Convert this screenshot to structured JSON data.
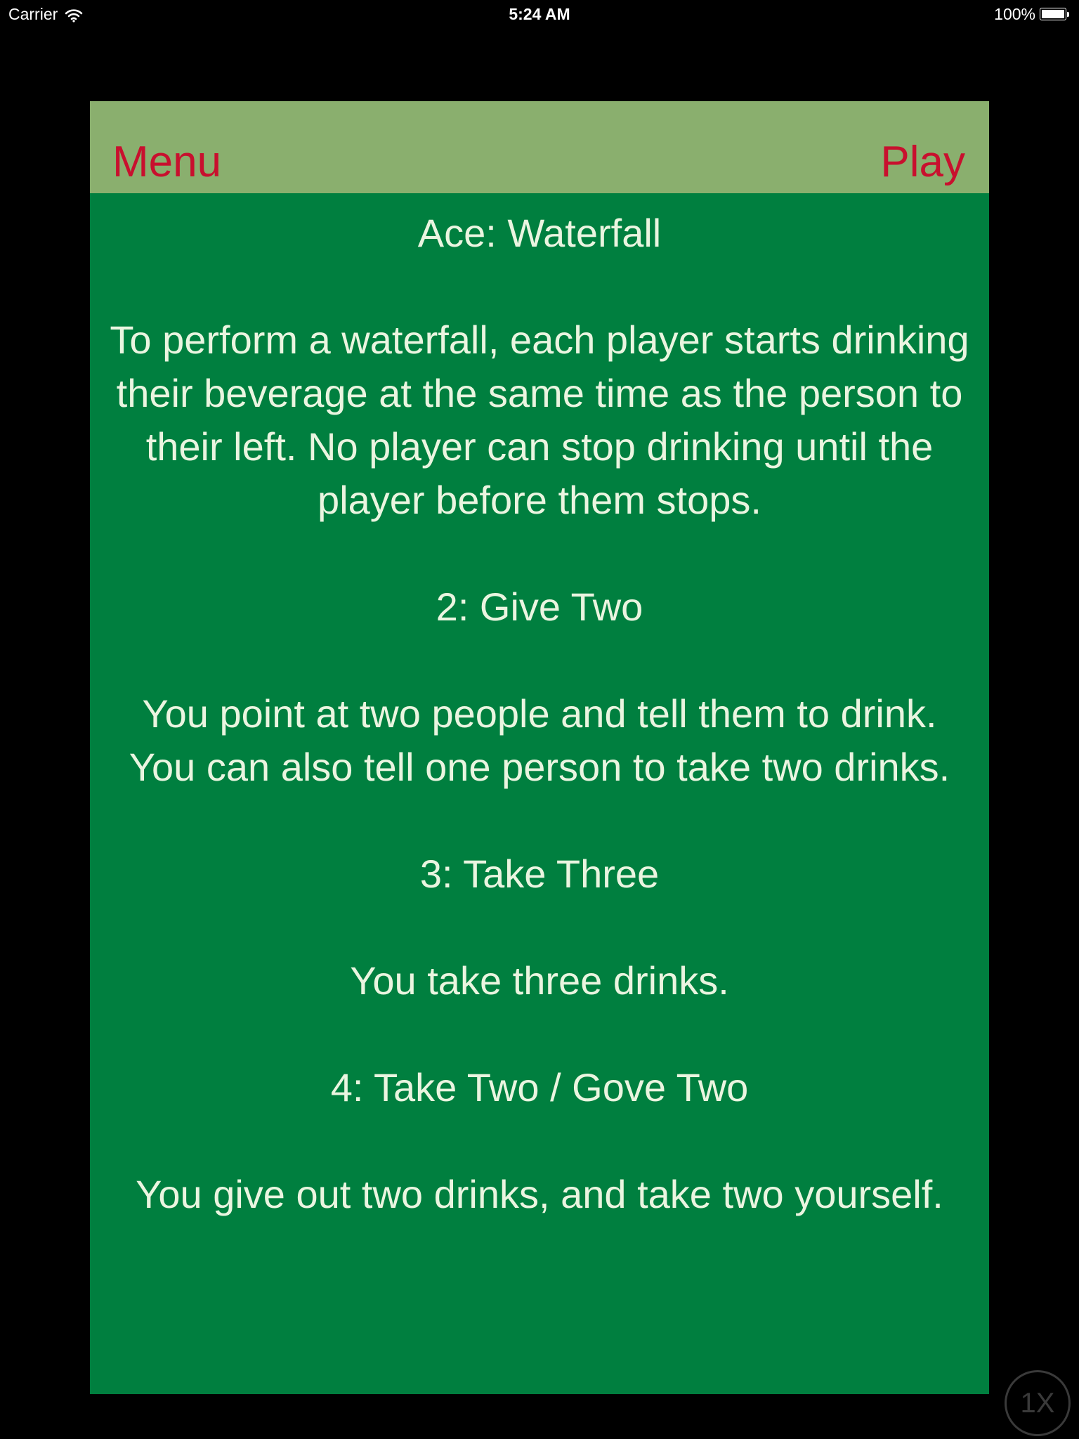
{
  "status_bar": {
    "carrier": "Carrier",
    "time": "5:24 AM",
    "battery": "100%",
    "battery_level": 1.0
  },
  "nav": {
    "left_label": "Menu",
    "right_label": "Play"
  },
  "colors": {
    "card_background": "#007f3f",
    "nav_background": "#8aaf6e",
    "nav_text": "#c8102e",
    "body_text": "#eaf5e0"
  },
  "rules": [
    {
      "title": "Ace: Waterfall",
      "description": "To perform a waterfall, each player starts drinking their beverage at the same time as the person to their left. No player can stop drinking until the player before them stops."
    },
    {
      "title": "2: Give Two",
      "description": "You point at two people and tell them to drink. You can also tell one person to take two drinks."
    },
    {
      "title": "3: Take Three",
      "description": "You take three drinks."
    },
    {
      "title": "4: Take Two / Gove Two",
      "description": "You give out two drinks, and take two yourself."
    }
  ],
  "zoom_indicator": "1X"
}
